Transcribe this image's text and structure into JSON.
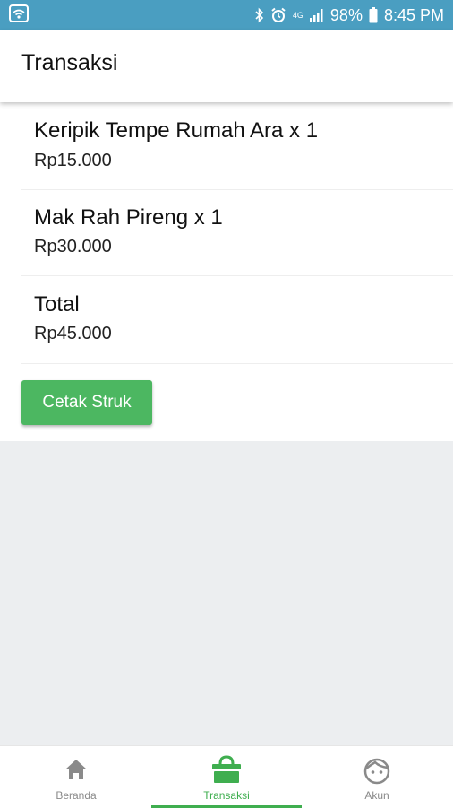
{
  "status_bar": {
    "network": "4G",
    "battery": "98%",
    "time": "8:45 PM"
  },
  "header": {
    "title": "Transaksi"
  },
  "items": [
    {
      "name": "Keripik Tempe Rumah Ara x 1",
      "price": "Rp15.000"
    },
    {
      "name": "Mak Rah Pireng x 1",
      "price": "Rp30.000"
    }
  ],
  "total": {
    "label": "Total",
    "value": "Rp45.000"
  },
  "actions": {
    "print_label": "Cetak Struk"
  },
  "bottom_nav": {
    "tabs": [
      {
        "label": "Beranda",
        "icon": "home-icon"
      },
      {
        "label": "Transaksi",
        "icon": "shopping-bag-icon",
        "active": true
      },
      {
        "label": "Akun",
        "icon": "face-icon"
      }
    ]
  },
  "colors": {
    "status_bar": "#4a9ec1",
    "accent": "#4cb761",
    "active_tab": "#3fae4f",
    "background": "#eceef0"
  }
}
